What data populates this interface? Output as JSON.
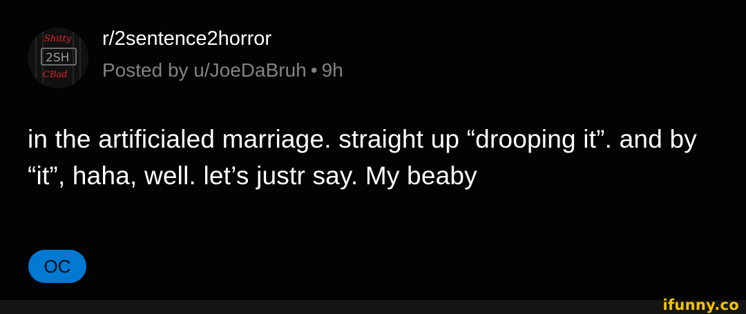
{
  "post": {
    "subreddit": "r/2sentence2horror",
    "posted_by": "Posted by u/JoeDaBruh",
    "separator": "•",
    "age": "9h",
    "title": "in the artificialed marriage. straight up “drooping it”. and by “it”, haha, well. let’s justr say. My beaby",
    "flair": "OC"
  },
  "avatar": {
    "icon": "subreddit-avatar-icon",
    "text_top": "Shitty",
    "text_mid": "2SH",
    "text_bot": "CBad"
  },
  "watermark": {
    "text": "ifunny.co"
  },
  "colors": {
    "background": "#030303",
    "title": "#ffffff",
    "meta": "#818384",
    "flair_bg": "#0079d3",
    "watermark": "#f5c400"
  }
}
